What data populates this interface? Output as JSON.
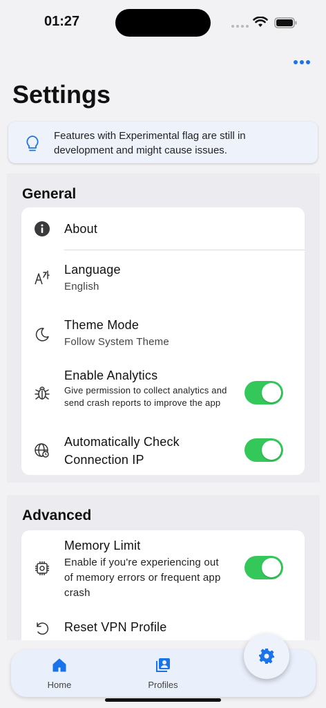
{
  "status_bar": {
    "time": "01:27"
  },
  "header": {
    "title": "Settings"
  },
  "banner": {
    "text": "Features with Experimental flag are still in development and might cause issues."
  },
  "general": {
    "title": "General",
    "items": [
      {
        "label": "About",
        "icon": "info-icon"
      },
      {
        "label": "Language",
        "value": "English",
        "icon": "language-icon"
      },
      {
        "label": "Theme Mode",
        "value": "Follow System Theme",
        "icon": "moon-icon"
      },
      {
        "label": "Enable Analytics",
        "description": "Give permission to collect analytics and send crash reports to improve the app",
        "icon": "bug-icon",
        "enabled": true
      },
      {
        "label": "Automatically Check Connection IP",
        "icon": "globe-icon",
        "enabled": true
      }
    ]
  },
  "advanced": {
    "title": "Advanced",
    "items": [
      {
        "label": "Memory Limit",
        "description": "Enable if you're experiencing out of memory errors or frequent app crash",
        "icon": "chip-icon",
        "enabled": true
      },
      {
        "label": "Reset VPN Profile",
        "icon": "reset-icon"
      }
    ]
  },
  "nav": {
    "items": [
      {
        "label": "Home",
        "icon": "home-icon"
      },
      {
        "label": "Profiles",
        "icon": "profiles-icon"
      }
    ],
    "fab_icon": "gear-icon"
  },
  "colors": {
    "accent": "#1a73e8",
    "toggle_on": "#34c759",
    "banner_bg": "#eef2fb"
  }
}
